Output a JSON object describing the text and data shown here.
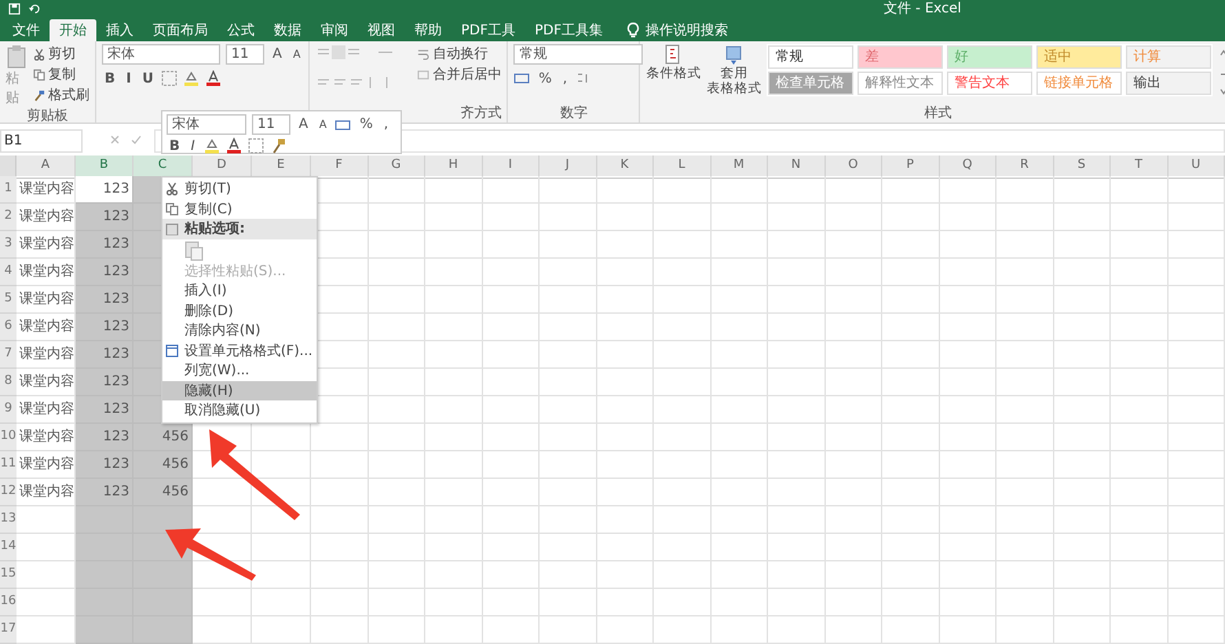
{
  "window": {
    "title": "文件 - Excel"
  },
  "tabs": [
    {
      "label": "文件",
      "selected": false
    },
    {
      "label": "开始",
      "selected": true
    },
    {
      "label": "插入",
      "selected": false
    },
    {
      "label": "页面布局",
      "selected": false
    },
    {
      "label": "公式",
      "selected": false
    },
    {
      "label": "数据",
      "selected": false
    },
    {
      "label": "审阅",
      "selected": false
    },
    {
      "label": "视图",
      "selected": false
    },
    {
      "label": "帮助",
      "selected": false
    },
    {
      "label": "PDF工具",
      "selected": false
    },
    {
      "label": "PDF工具集",
      "selected": false
    }
  ],
  "search": {
    "label": "操作说明搜索"
  },
  "clipboard": {
    "paste": "粘贴",
    "cut": "剪切",
    "copy": "复制",
    "painter": "格式刷",
    "label": "剪贴板"
  },
  "font": {
    "name": "宋体",
    "size": "11",
    "grow": "A",
    "shrink": "A",
    "styles": [
      "B",
      "I",
      "U"
    ]
  },
  "alignment": {
    "wrap": "自动换行",
    "merge": "合并后居中",
    "label": "齐方式"
  },
  "number": {
    "format": "常规",
    "symbols": [
      "%",
      ","
    ],
    "label": "数字"
  },
  "styles": {
    "conditional": "条件格式",
    "table_line1": "套用",
    "table_line2": "表格格式",
    "label": "样式",
    "cells": [
      {
        "label": "常规",
        "kind": "normal",
        "color": "#ffffff"
      },
      {
        "label": "差",
        "kind": "bad",
        "color": "#ffc7ce"
      },
      {
        "label": "好",
        "kind": "good",
        "color": "#c6efce"
      },
      {
        "label": "适中",
        "kind": "neutral",
        "color": "#ffeb9c"
      },
      {
        "label": "计算",
        "kind": "calculation",
        "color": "#f2f2f2"
      },
      {
        "label": "检查单元格",
        "kind": "check",
        "color": "#a5a5a5"
      },
      {
        "label": "解释性文本",
        "kind": "explanatory",
        "color": "#ffffff"
      },
      {
        "label": "警告文本",
        "kind": "warning",
        "color": "#ffffff"
      },
      {
        "label": "链接单元格",
        "kind": "linked",
        "color": "#ffffff"
      },
      {
        "label": "输出",
        "kind": "output",
        "color": "#f2f2f2"
      }
    ]
  },
  "mini_toolbar": {
    "font": "宋体",
    "size": "11",
    "grow": "A",
    "shrink": "A",
    "symbols": [
      "%",
      ","
    ],
    "styles": [
      "B",
      "I"
    ]
  },
  "name_box": "B1",
  "columns": [
    {
      "label": "A",
      "selected": false
    },
    {
      "label": "B",
      "selected": true
    },
    {
      "label": "C",
      "selected": true
    },
    {
      "label": "D",
      "selected": false
    },
    {
      "label": "E",
      "selected": false
    },
    {
      "label": "F",
      "selected": false
    },
    {
      "label": "G",
      "selected": false
    },
    {
      "label": "H",
      "selected": false
    },
    {
      "label": "I",
      "selected": false
    },
    {
      "label": "J",
      "selected": false
    },
    {
      "label": "K",
      "selected": false
    },
    {
      "label": "L",
      "selected": false
    },
    {
      "label": "M",
      "selected": false
    },
    {
      "label": "N",
      "selected": false
    },
    {
      "label": "O",
      "selected": false
    },
    {
      "label": "P",
      "selected": false
    },
    {
      "label": "Q",
      "selected": false
    },
    {
      "label": "R",
      "selected": false
    },
    {
      "label": "S",
      "selected": false
    },
    {
      "label": "T",
      "selected": false
    },
    {
      "label": "U",
      "selected": false
    }
  ],
  "rows": [
    {
      "number": "1",
      "active": true,
      "a": "课堂内容",
      "b": "123"
    },
    {
      "number": "2",
      "active": false,
      "a": "课堂内容",
      "b": "123"
    },
    {
      "number": "3",
      "active": false,
      "a": "课堂内容",
      "b": "123"
    },
    {
      "number": "4",
      "active": false,
      "a": "课堂内容",
      "b": "123"
    },
    {
      "number": "5",
      "active": false,
      "a": "课堂内容",
      "b": "123"
    },
    {
      "number": "6",
      "active": false,
      "a": "课堂内容",
      "b": "123"
    },
    {
      "number": "7",
      "active": false,
      "a": "课堂内容",
      "b": "123"
    },
    {
      "number": "8",
      "active": false,
      "a": "课堂内容",
      "b": "123"
    },
    {
      "number": "9",
      "active": false,
      "a": "课堂内容",
      "b": "123"
    },
    {
      "number": "10",
      "active": false,
      "a": "课堂内容",
      "b": "123",
      "c": "456"
    },
    {
      "number": "11",
      "active": false,
      "a": "课堂内容",
      "b": "123",
      "c": "456"
    },
    {
      "number": "12",
      "active": false,
      "a": "课堂内容",
      "b": "123",
      "c": "456"
    },
    {
      "number": "13",
      "active": false
    },
    {
      "number": "14",
      "active": false
    },
    {
      "number": "15",
      "active": false
    },
    {
      "number": "16",
      "active": false
    },
    {
      "number": "17",
      "active": false
    }
  ],
  "context_menu": {
    "items": [
      {
        "kind": "item",
        "label": "剪切(T)",
        "disabled": false,
        "selected": false
      },
      {
        "kind": "item",
        "label": "复制(C)",
        "disabled": false,
        "selected": false
      },
      {
        "kind": "header",
        "label": "粘贴选项:"
      },
      {
        "kind": "paste"
      },
      {
        "kind": "item",
        "label": "选择性粘贴(S)...",
        "disabled": true,
        "selected": false
      },
      {
        "kind": "item",
        "label": "插入(I)",
        "disabled": false,
        "selected": false
      },
      {
        "kind": "item",
        "label": "删除(D)",
        "disabled": false,
        "selected": false
      },
      {
        "kind": "item",
        "label": "清除内容(N)",
        "disabled": false,
        "selected": false
      },
      {
        "kind": "item",
        "label": "设置单元格格式(F)...",
        "disabled": false,
        "selected": false
      },
      {
        "kind": "item",
        "label": "列宽(W)...",
        "disabled": false,
        "selected": false
      },
      {
        "kind": "item",
        "label": "隐藏(H)",
        "disabled": false,
        "selected": true
      },
      {
        "kind": "item",
        "label": "取消隐藏(U)",
        "disabled": false,
        "selected": false
      }
    ]
  }
}
